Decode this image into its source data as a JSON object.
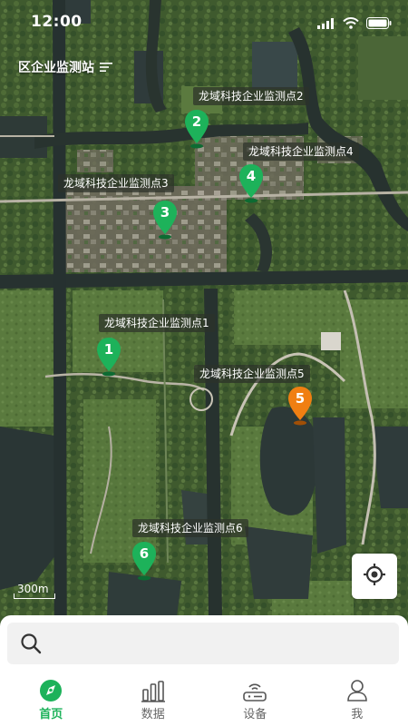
{
  "status_bar": {
    "time": "12:00"
  },
  "header": {
    "station_filter_label": "区企业监测站"
  },
  "markers": [
    {
      "id": "1",
      "label": "龙域科技企业监测点1",
      "color": "#1db25a"
    },
    {
      "id": "2",
      "label": "龙域科技企业监测点2",
      "color": "#1db25a"
    },
    {
      "id": "3",
      "label": "龙域科技企业监测点3",
      "color": "#1db25a"
    },
    {
      "id": "4",
      "label": "龙域科技企业监测点4",
      "color": "#1db25a"
    },
    {
      "id": "5",
      "label": "龙域科技企业监测点5",
      "color": "#f07f12"
    },
    {
      "id": "6",
      "label": "龙域科技企业监测点6",
      "color": "#1db25a"
    }
  ],
  "map": {
    "scale_label": "300m"
  },
  "search": {
    "value": "",
    "placeholder": ""
  },
  "tabs": [
    {
      "label": "首页",
      "icon": "home-compass-icon",
      "active": true
    },
    {
      "label": "数据",
      "icon": "bar-chart-icon",
      "active": false
    },
    {
      "label": "设备",
      "icon": "router-device-icon",
      "active": false
    },
    {
      "label": "我",
      "icon": "user-icon",
      "active": false
    }
  ],
  "colors": {
    "accent": "#1db25a",
    "warning": "#f07f12",
    "inactive": "#666666"
  }
}
